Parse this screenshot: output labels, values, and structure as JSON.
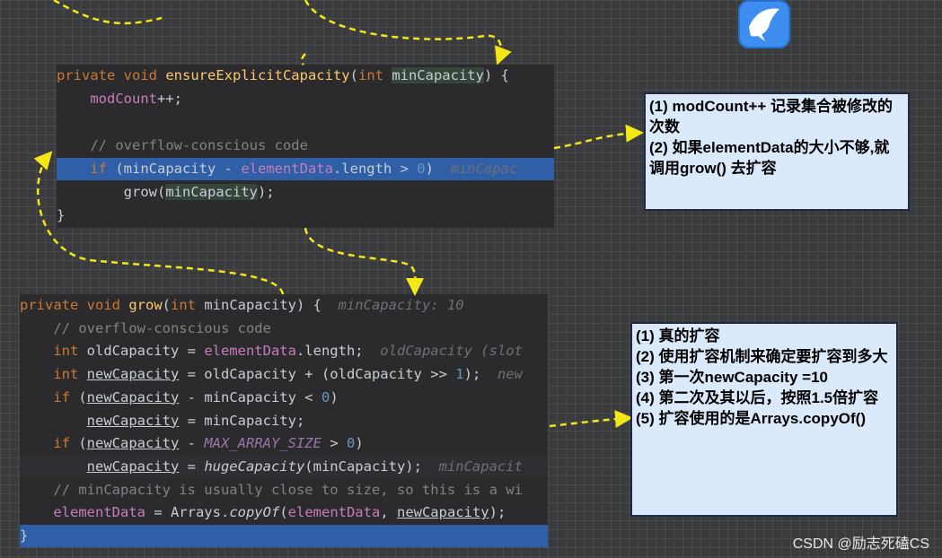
{
  "code_top": [
    {
      "segs": [
        [
          "kw",
          "private void "
        ],
        [
          "fn",
          "ensureExplicitCapacity"
        ],
        [
          "",
          "("
        ],
        [
          "kw",
          "int "
        ],
        [
          "param-box",
          "minCapacity"
        ],
        [
          "",
          ") {"
        ]
      ]
    },
    {
      "segs": [
        [
          "",
          "    "
        ],
        [
          "field",
          "modCount"
        ],
        [
          "",
          "++;"
        ]
      ]
    },
    {
      "segs": [
        [
          "",
          ""
        ]
      ]
    },
    {
      "segs": [
        [
          "cm",
          "    // overflow-conscious code"
        ]
      ]
    },
    {
      "cls": "hl",
      "segs": [
        [
          "",
          "    "
        ],
        [
          "kw",
          "if "
        ],
        [
          "",
          "(minCapacity - "
        ],
        [
          "field",
          "elementData"
        ],
        [
          "",
          ".length > "
        ],
        [
          "num",
          "0"
        ],
        [
          "",
          ")  "
        ],
        [
          "hint",
          "minCapac"
        ]
      ]
    },
    {
      "segs": [
        [
          "",
          "        grow("
        ],
        [
          "param-box",
          "minCapacity"
        ],
        [
          "",
          ");"
        ]
      ]
    },
    {
      "segs": [
        [
          "",
          "}"
        ]
      ]
    }
  ],
  "code_bottom": [
    {
      "segs": [
        [
          "kw",
          "private void "
        ],
        [
          "fn",
          "grow"
        ],
        [
          "",
          "("
        ],
        [
          "kw",
          "int "
        ],
        [
          "",
          "minCapacity) {  "
        ],
        [
          "hint",
          "minCapacity: 10"
        ]
      ]
    },
    {
      "segs": [
        [
          "cm",
          "    // overflow-conscious code"
        ]
      ]
    },
    {
      "segs": [
        [
          "kw",
          "    int "
        ],
        [
          "",
          "oldCapacity = "
        ],
        [
          "field",
          "elementData"
        ],
        [
          "",
          ".length;  "
        ],
        [
          "hint",
          "oldCapacity (slot"
        ]
      ]
    },
    {
      "segs": [
        [
          "kw",
          "    int "
        ],
        [
          "ul",
          "newCapacity"
        ],
        [
          "",
          " = oldCapacity + (oldCapacity >> "
        ],
        [
          "num",
          "1"
        ],
        [
          "",
          ");  "
        ],
        [
          "hint",
          "new"
        ]
      ]
    },
    {
      "segs": [
        [
          "kw",
          "    if "
        ],
        [
          "",
          "("
        ],
        [
          "ul",
          "newCapacity"
        ],
        [
          "",
          " - minCapacity < "
        ],
        [
          "num",
          "0"
        ],
        [
          "",
          ")"
        ]
      ]
    },
    {
      "segs": [
        [
          "",
          "        "
        ],
        [
          "ul",
          "newCapacity"
        ],
        [
          "",
          " = minCapacity;"
        ]
      ]
    },
    {
      "segs": [
        [
          "kw",
          "    if "
        ],
        [
          "",
          "("
        ],
        [
          "ul",
          "newCapacity"
        ],
        [
          "",
          " - "
        ],
        [
          "const",
          "MAX_ARRAY_SIZE"
        ],
        [
          "",
          " > "
        ],
        [
          "num",
          "0"
        ],
        [
          "",
          ")"
        ]
      ]
    },
    {
      "cls": "hl-soft",
      "segs": [
        [
          "",
          "        "
        ],
        [
          "ul",
          "newCapacity"
        ],
        [
          "",
          " = "
        ],
        [
          "italic",
          "hugeCapacity"
        ],
        [
          "",
          "(minCapacity);  "
        ],
        [
          "hint",
          "minCapacit"
        ]
      ]
    },
    {
      "segs": [
        [
          "cm",
          "    // minCapacity is usually close to size, so this is a wi"
        ]
      ]
    },
    {
      "segs": [
        [
          "field",
          "    elementData"
        ],
        [
          "",
          " = Arrays."
        ],
        [
          "italic",
          "copyOf"
        ],
        [
          "",
          "("
        ],
        [
          "field",
          "elementData"
        ],
        [
          ", ",
          ""
        ],
        [
          "ul",
          "newCapacity"
        ],
        [
          "",
          ");"
        ]
      ]
    },
    {
      "cls": "hl",
      "segs": [
        [
          "",
          "}"
        ]
      ]
    }
  ],
  "note_top": [
    "(1)  modCount++ 记录集合被修改的次数",
    "(2) 如果elementData的大小不够,就调用grow() 去扩容"
  ],
  "note_bottom": [
    "(1) 真的扩容",
    "(2) 使用扩容机制来确定要扩容到多大",
    "(3) 第一次newCapacity =10",
    "(4) 第二次及其以后，按照1.5倍扩容",
    "(5) 扩容使用的是Arrays.copyOf()"
  ],
  "watermark": "CSDN @励志死磕CS",
  "logo_icon": "bird-icon",
  "colors": {
    "arrow": "#f5e616",
    "note_bg": "#dbeafb",
    "highlight": "#2f5fa6"
  }
}
